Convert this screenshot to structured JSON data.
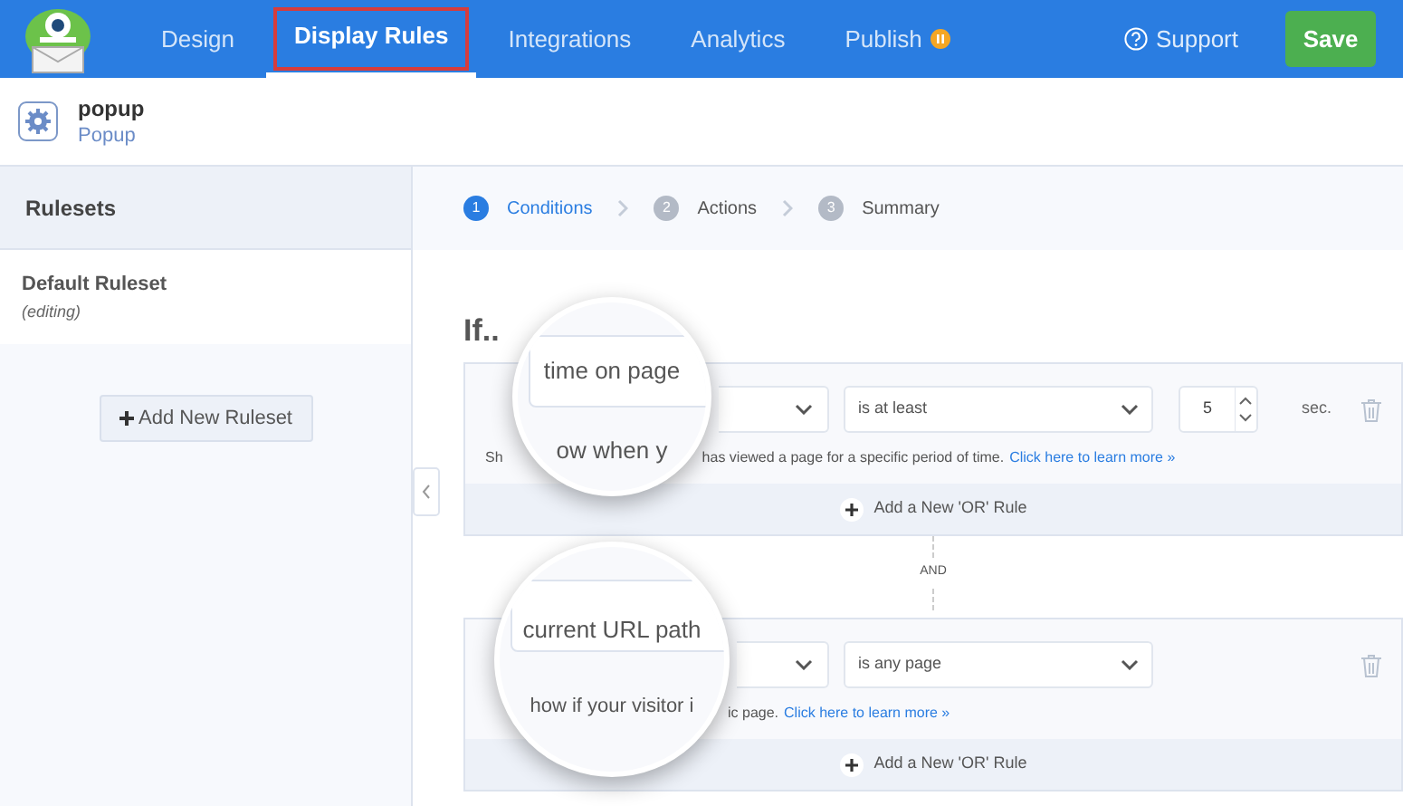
{
  "nav": [
    {
      "label": "Design",
      "selected": false
    },
    {
      "label": "Display Rules",
      "selected": true,
      "highlighted": true
    },
    {
      "label": "Integrations",
      "selected": false
    },
    {
      "label": "Analytics",
      "selected": false
    },
    {
      "label": "Publish",
      "selected": false,
      "badge": true
    }
  ],
  "support": "Support",
  "save": "Save",
  "campaign": {
    "name": "popup",
    "type": "Popup"
  },
  "sidebar": {
    "title": "Rulesets",
    "items": [
      {
        "name": "Default Ruleset",
        "note": "(editing)"
      }
    ],
    "add_button": "Add New Ruleset"
  },
  "steps": [
    {
      "number": "1",
      "label": "Conditions",
      "selected": true
    },
    {
      "number": "2",
      "label": "Actions",
      "selected": false
    },
    {
      "number": "3",
      "label": "Summary",
      "selected": false
    }
  ],
  "heading": "If..",
  "rules": [
    {
      "kind": "timed",
      "field": "time on page",
      "help_prefix": "Sh",
      "lens_help": "ow when y",
      "help": "has viewed a page for a specific period of time.",
      "link": "Click here to learn more »",
      "operator": "is at least",
      "value": "5",
      "unit": "sec.",
      "or_button": "Add a New 'OR' Rule"
    },
    {
      "kind": "plain",
      "field": "current URL path",
      "lens_help": "how if your visitor i",
      "help": "ic page.",
      "link": "Click here to learn more »",
      "operator": "is any page",
      "or_button": "Add a New 'OR' Rule"
    }
  ],
  "connector": "AND"
}
